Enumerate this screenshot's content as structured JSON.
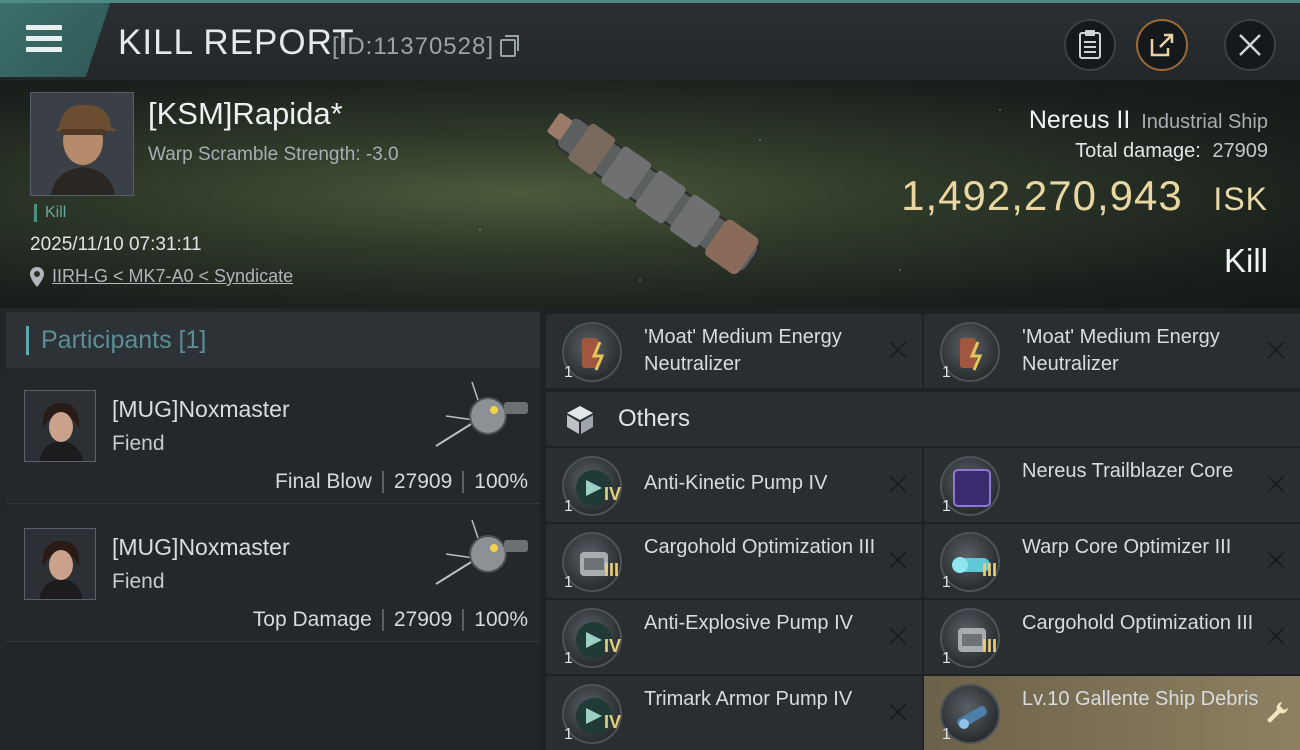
{
  "header": {
    "title": "KILL REPORT",
    "report_id": "[ID:11370528]"
  },
  "victim": {
    "name": "[KSM]Rapida*",
    "warp_scramble": "Warp Scramble Strength: -3.0",
    "tag": "Kill",
    "datetime": "2025/11/10 07:31:11",
    "location": "IIRH-G < MK7-A0 < Syndicate",
    "ship_name": "Nereus II",
    "ship_class": "Industrial Ship",
    "total_damage_label": "Total damage:",
    "total_damage": "27909",
    "isk_value": "1,492,270,943",
    "isk_unit": "ISK",
    "result": "Kill"
  },
  "participants": {
    "header": "Participants [1]",
    "list": [
      {
        "name": "[MUG]Noxmaster",
        "ship": "Fiend",
        "role": "Final Blow",
        "damage": "27909",
        "percent": "100%"
      },
      {
        "name": "[MUG]Noxmaster",
        "ship": "Fiend",
        "role": "Top Damage",
        "damage": "27909",
        "percent": "100%"
      }
    ]
  },
  "items": {
    "top_row": [
      {
        "name": "'Moat' Medium Energy Neutralizer",
        "qty": "1",
        "tier": ""
      },
      {
        "name": "'Moat' Medium Energy Neutralizer",
        "qty": "1",
        "tier": ""
      }
    ],
    "others_label": "Others",
    "others": [
      {
        "name": "Anti-Kinetic Pump IV",
        "qty": "1",
        "tier": "IV"
      },
      {
        "name": "Nereus Trailblazer Core",
        "qty": "1",
        "tier": ""
      },
      {
        "name": "Cargohold Optimization III",
        "qty": "1",
        "tier": "III"
      },
      {
        "name": "Warp Core Optimizer III",
        "qty": "1",
        "tier": "III"
      },
      {
        "name": "Anti-Explosive Pump IV",
        "qty": "1",
        "tier": "IV"
      },
      {
        "name": "Cargohold Optimization III",
        "qty": "1",
        "tier": "III"
      },
      {
        "name": "Trimark Armor Pump IV",
        "qty": "1",
        "tier": "IV"
      },
      {
        "name": "Lv.10 Gallente Ship Debris",
        "qty": "1",
        "tier": ""
      }
    ]
  },
  "colors": {
    "accent_teal": "#4f8a86",
    "isk_gold": "#e9d6a0",
    "highlight_slot": "#8d8062"
  }
}
